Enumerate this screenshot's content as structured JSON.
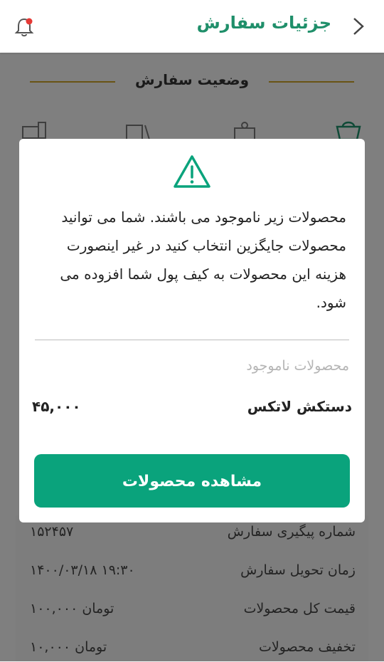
{
  "header": {
    "title": "جزئیات سفارش",
    "back_icon": "chevron-right-icon",
    "notification_icon": "bell-icon"
  },
  "status": {
    "title": "وضعیت سفارش",
    "line_color": "#c9a227"
  },
  "order_info": {
    "rows": [
      {
        "label": "شماره پیگیری سفارش",
        "value": "۱۵۲۴۵۷"
      },
      {
        "label": "زمان تحویل سفارش",
        "value": "۱۴۰۰/۰۳/۱۸  ۱۹:۳۰"
      },
      {
        "label": "قیمت کل محصولات",
        "value": "۱۰۰,۰۰۰ تومان"
      },
      {
        "label": "تخفیف محصولات",
        "value": "۱۰,۰۰۰ تومان"
      }
    ]
  },
  "modal": {
    "icon": "warning-icon",
    "message": "محصولات زیر ناموجود می باشند. شما می توانید محصولات جایگزین انتخاب کنید در غیر اینصورت هزینه این محصولات به کیف پول شما افزوده می شود.",
    "unavailable_label": "محصولات ناموجود",
    "items": [
      {
        "name": "دستکش لاتکس",
        "price": "۴۵,۰۰۰"
      }
    ],
    "button_label": "مشاهده محصولات"
  },
  "colors": {
    "primary": "#0aa37c",
    "title_green": "#1f8f6a"
  }
}
